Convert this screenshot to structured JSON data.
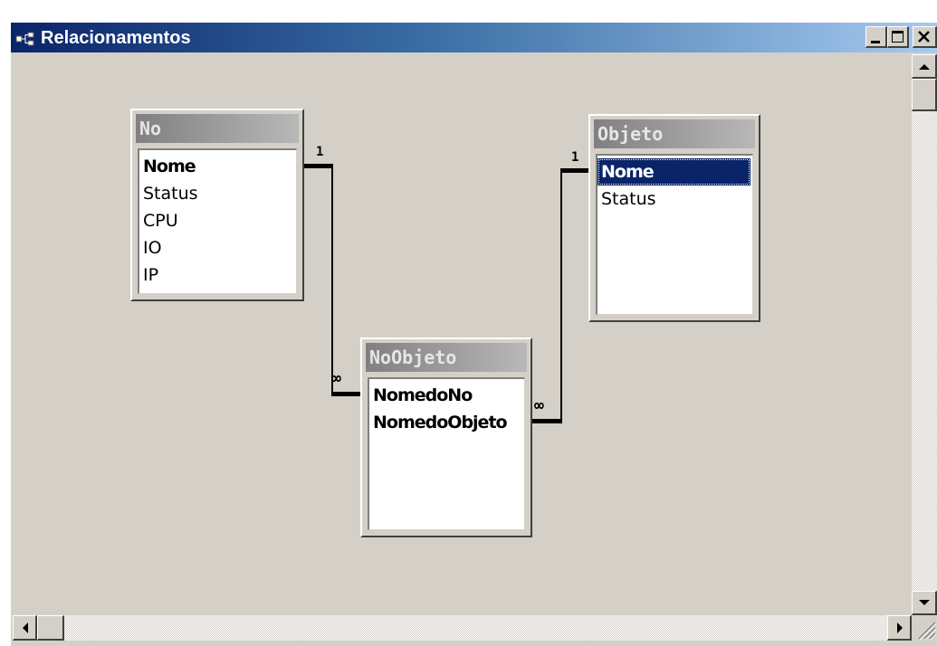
{
  "window": {
    "title": "Relacionamentos",
    "icon": "relationships-icon",
    "controls": [
      "minimize-icon",
      "maximize-icon",
      "close-icon"
    ]
  },
  "tables": [
    {
      "name": "No",
      "fields": [
        {
          "label": "Nome",
          "key": true
        },
        {
          "label": "Status",
          "key": false
        },
        {
          "label": "CPU",
          "key": false
        },
        {
          "label": "IO",
          "key": false
        },
        {
          "label": "IP",
          "key": false
        }
      ]
    },
    {
      "name": "NoObjeto",
      "fields": [
        {
          "label": "NomedoNo",
          "key": true
        },
        {
          "label": "NomedoObjeto",
          "key": true
        }
      ]
    },
    {
      "name": "Objeto",
      "fields": [
        {
          "label": "Nome",
          "key": true,
          "selected": true
        },
        {
          "label": "Status",
          "key": false
        }
      ]
    }
  ],
  "relationships": [
    {
      "from": "No.Nome",
      "to": "NoObjeto.NomedoNo",
      "one_label": "1",
      "many_label": "∞"
    },
    {
      "from": "Objeto.Nome",
      "to": "NoObjeto.NomedoObjeto",
      "one_label": "1",
      "many_label": "∞"
    }
  ],
  "colors": {
    "titlebar_start": "#0a246a",
    "titlebar_end": "#a6caf0",
    "selection": "#0a246a",
    "surface": "#d4d0c8"
  }
}
